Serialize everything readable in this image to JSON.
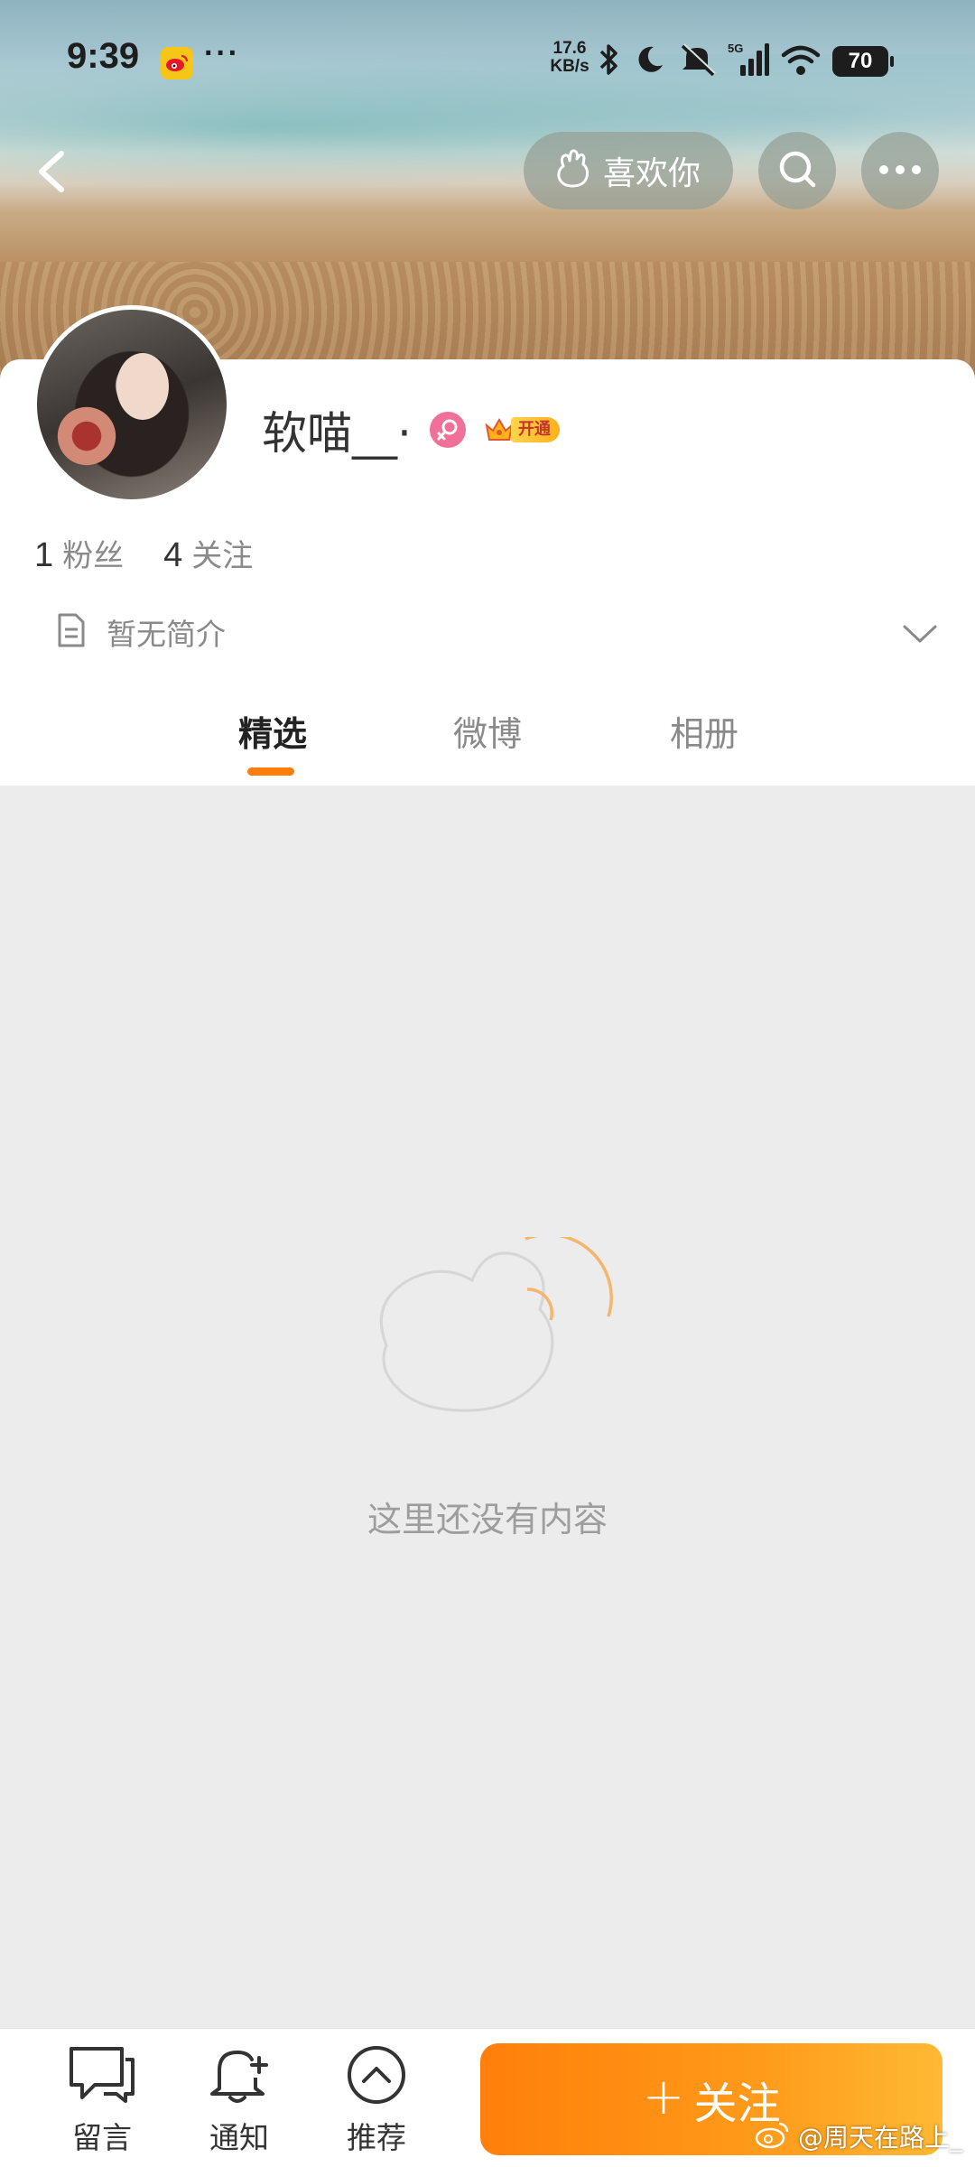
{
  "status_bar": {
    "time": "9:39",
    "net_speed_value": "17.6",
    "net_speed_unit": "KB/s",
    "network": "5G",
    "battery": "70",
    "icons": [
      "weibo-app-icon",
      "bluetooth-icon",
      "moon-icon",
      "mute-icon",
      "signal-icon",
      "wifi-icon",
      "battery-icon"
    ]
  },
  "header": {
    "like_label": "喜欢你",
    "icons": [
      "back-icon",
      "paw-icon",
      "search-icon",
      "more-icon"
    ]
  },
  "profile": {
    "name": "软喵__·",
    "gender": "female",
    "vip_label": "开通",
    "followers_count": "1",
    "followers_label": "粉丝",
    "following_count": "4",
    "following_label": "关注",
    "bio": "暂无简介"
  },
  "tabs": [
    {
      "label": "精选",
      "active": true
    },
    {
      "label": "微博",
      "active": false
    },
    {
      "label": "相册",
      "active": false
    }
  ],
  "empty_state": {
    "message": "这里还没有内容"
  },
  "bottom_bar": {
    "message_label": "留言",
    "notify_label": "通知",
    "recommend_label": "推荐",
    "follow_label": "关注"
  },
  "watermark": "@周天在路上_",
  "colors": {
    "accent": "#ff7d0c",
    "follow_gradient_start": "#ff7f0a",
    "follow_gradient_end": "#ffb934",
    "gender_female": "#f0709a",
    "text_primary": "#333333",
    "text_secondary": "#8a8a8a",
    "page_bg": "#ececec"
  }
}
